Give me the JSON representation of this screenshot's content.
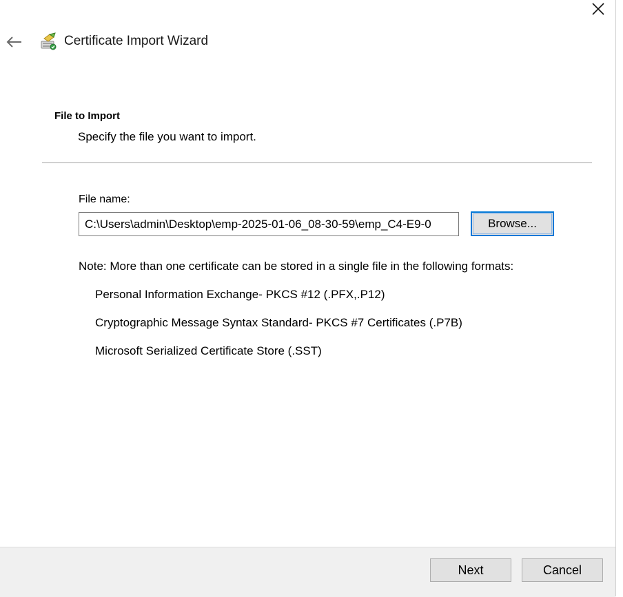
{
  "window": {
    "title": "Certificate Import Wizard",
    "close_icon": "close-icon",
    "back_icon": "back-arrow-icon",
    "title_icon": "certificate-wizard-icon"
  },
  "section": {
    "heading": "File to Import",
    "description": "Specify the file you want to import."
  },
  "file": {
    "label": "File name:",
    "value": "C:\\Users\\admin\\Desktop\\emp-2025-01-06_08-30-59\\emp_C4-E9-0",
    "browse_label": "Browse..."
  },
  "note": {
    "text": "Note:  More than one certificate can be stored in a single file in the following formats:",
    "formats": [
      "Personal Information Exchange- PKCS #12 (.PFX,.P12)",
      "Cryptographic Message Syntax Standard- PKCS #7 Certificates (.P7B)",
      "Microsoft Serialized Certificate Store (.SST)"
    ]
  },
  "footer": {
    "next_label": "Next",
    "cancel_label": "Cancel"
  },
  "colors": {
    "accent": "#0078d7",
    "footer_bg": "#f0f0f0",
    "button_bg": "#e1e1e1"
  }
}
